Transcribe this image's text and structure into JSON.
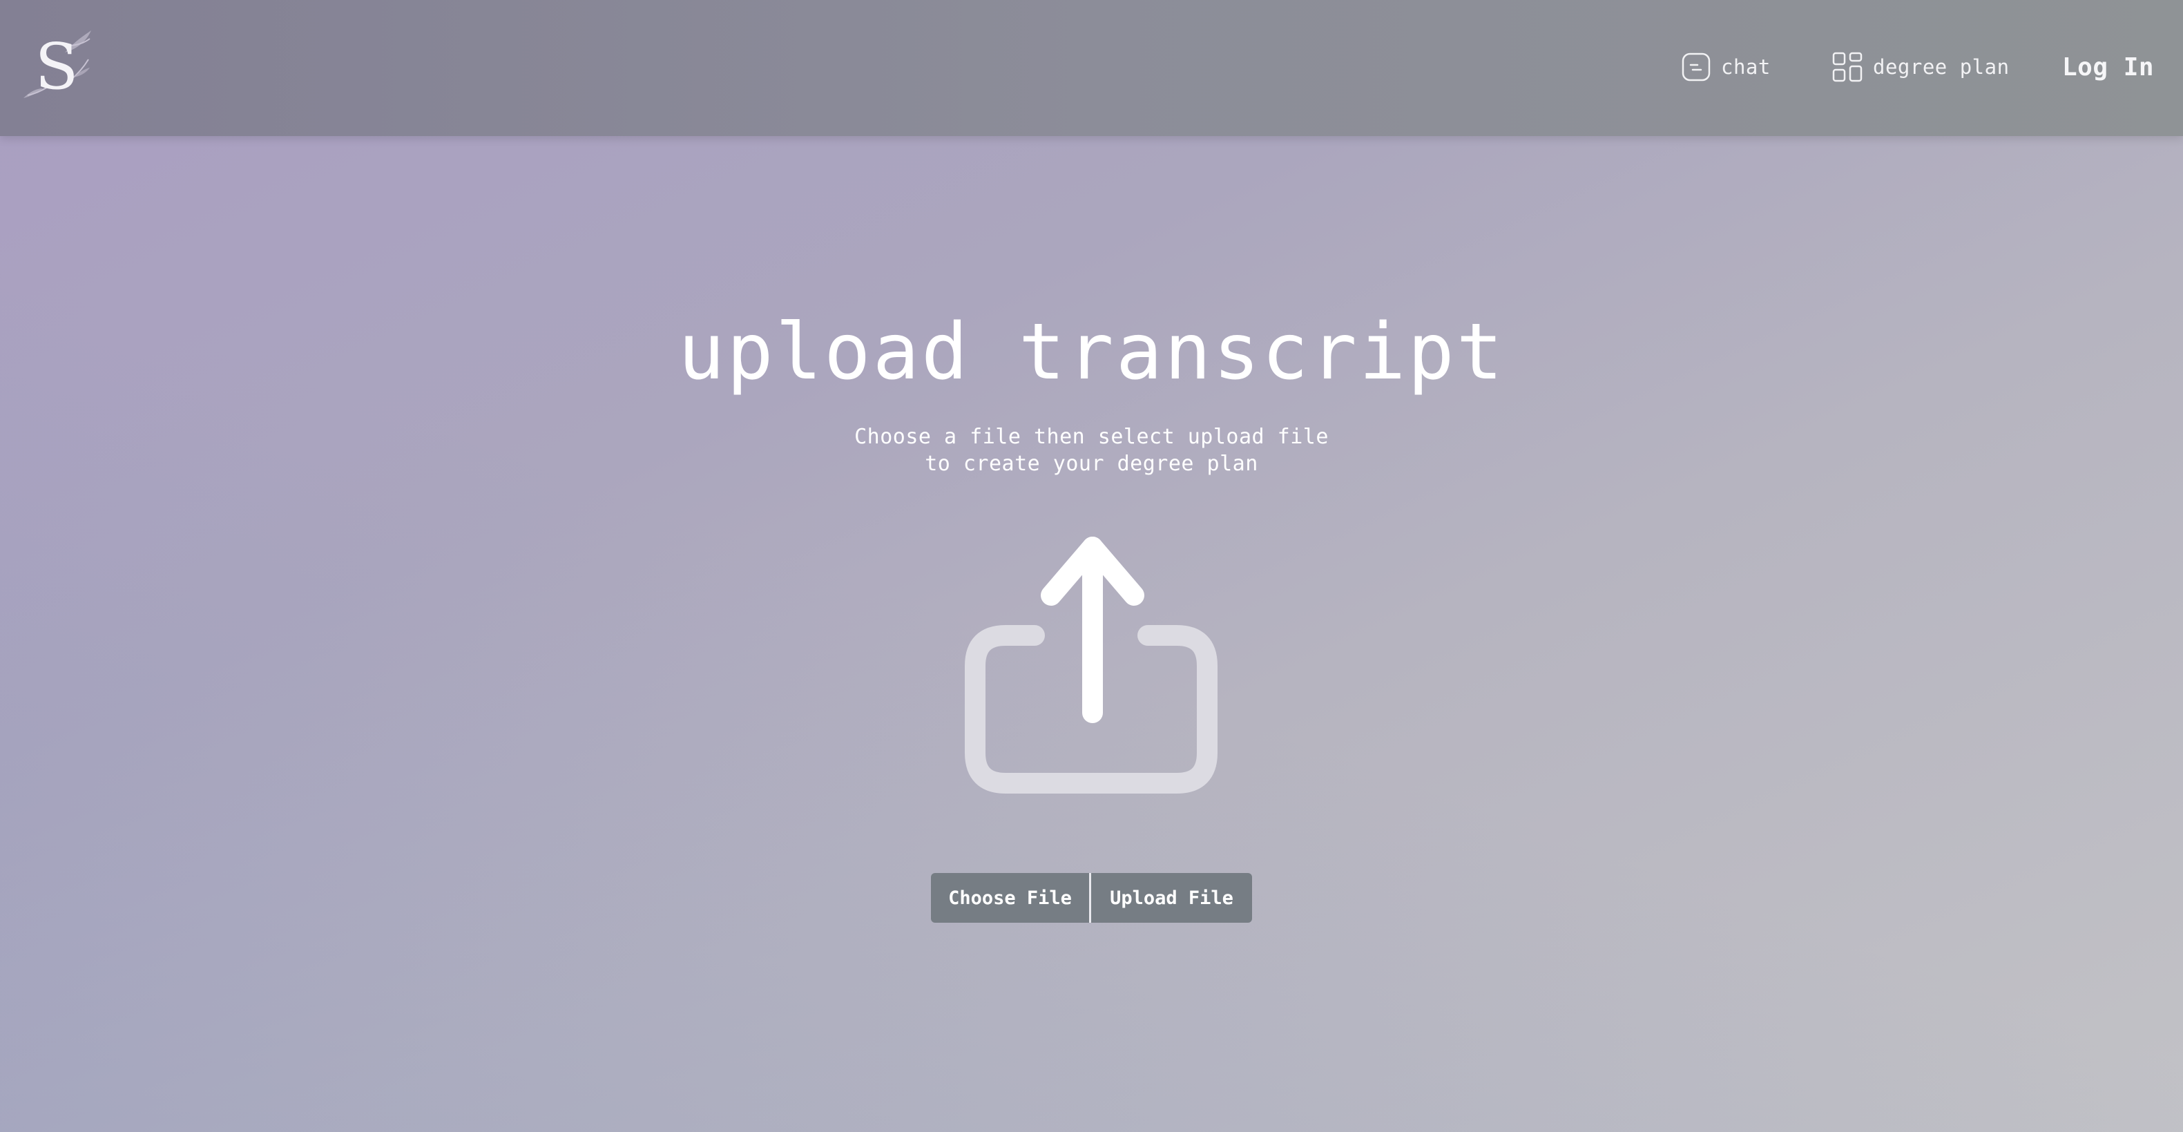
{
  "header": {
    "logo_letter": "S",
    "nav": [
      {
        "label": "chat",
        "icon": "chat-icon"
      },
      {
        "label": "degree plan",
        "icon": "grid-icon"
      }
    ],
    "login_label": "Log In"
  },
  "main": {
    "title": "upload transcript",
    "subtitle_line1": "Choose a file then select upload file",
    "subtitle_line2": "to create your degree plan",
    "graphic_icon": "upload-icon",
    "choose_button": "Choose File",
    "upload_button": "Upload File"
  },
  "colors": {
    "header_bg": "#8a8a98",
    "button_bg": "#767d84",
    "text": "#ffffff",
    "icon_light": "#dcdbe2"
  }
}
